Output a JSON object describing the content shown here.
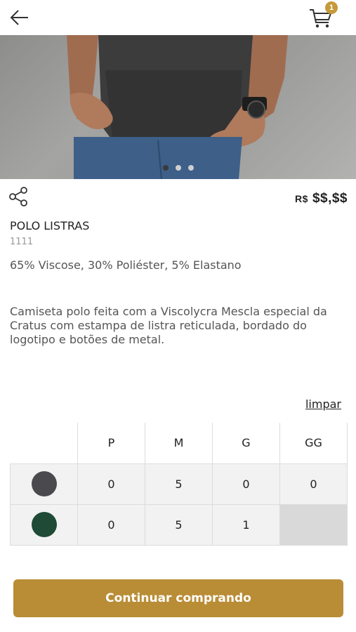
{
  "header": {
    "back_icon": "arrow-left-icon",
    "cart_icon": "cart-icon",
    "cart_count": "1",
    "accent_color": "#c69a3a"
  },
  "gallery": {
    "image": "product-photo",
    "slides": 3,
    "active_slide": 1
  },
  "product": {
    "share_icon": "share-icon",
    "price_currency": "R$",
    "price_value": "$$,$$",
    "title": "POLO LISTRAS",
    "sku": "1111",
    "composition": "65% Viscose, 30% Poliéster, 5% Elastano",
    "description": "Camiseta polo feita com a Viscolycra Mescla especial da Cratus com estampa de listra reticulada, bordado do logotipo e botões de metal."
  },
  "size_grid": {
    "clear_label": "limpar",
    "sizes": [
      "P",
      "M",
      "G",
      "GG"
    ],
    "rows": [
      {
        "color": "#4a4a4e",
        "quantities": [
          "0",
          "5",
          "0",
          "0"
        ]
      },
      {
        "color": "#1f4a35",
        "quantities": [
          "0",
          "5",
          "1",
          ""
        ]
      }
    ]
  },
  "cta": {
    "label": "Continuar comprando",
    "color": "#b98d36"
  }
}
